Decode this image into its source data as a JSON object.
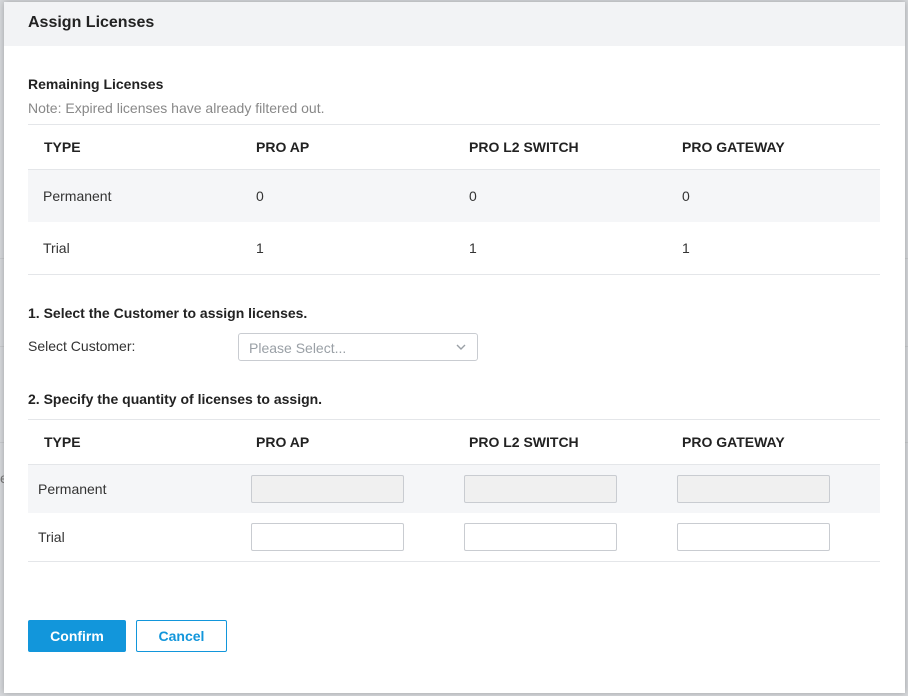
{
  "dialog": {
    "title": "Assign Licenses"
  },
  "remaining": {
    "heading": "Remaining Licenses",
    "note": "Note: Expired licenses have already filtered out.",
    "columns": [
      "TYPE",
      "PRO AP",
      "PRO L2 SWITCH",
      "PRO GATEWAY"
    ],
    "rows": [
      {
        "type": "Permanent",
        "pro_ap": "0",
        "pro_l2_switch": "0",
        "pro_gateway": "0"
      },
      {
        "type": "Trial",
        "pro_ap": "1",
        "pro_l2_switch": "1",
        "pro_gateway": "1"
      }
    ]
  },
  "step1": {
    "heading": "1. Select the Customer to assign licenses.",
    "label": "Select Customer:",
    "placeholder": "Please Select..."
  },
  "step2": {
    "heading": "2. Specify the quantity of licenses to assign.",
    "columns": [
      "TYPE",
      "PRO AP",
      "PRO L2 SWITCH",
      "PRO GATEWAY"
    ],
    "rows": [
      {
        "type": "Permanent",
        "disabled": true,
        "pro_ap": "",
        "pro_l2_switch": "",
        "pro_gateway": ""
      },
      {
        "type": "Trial",
        "disabled": false,
        "pro_ap": "",
        "pro_l2_switch": "",
        "pro_gateway": ""
      }
    ]
  },
  "actions": {
    "confirm": "Confirm",
    "cancel": "Cancel"
  },
  "background": {
    "partial_char": "e"
  },
  "colors": {
    "accent": "#1296db",
    "header_bg": "#f2f3f5",
    "row_shade": "#f5f6f8"
  }
}
